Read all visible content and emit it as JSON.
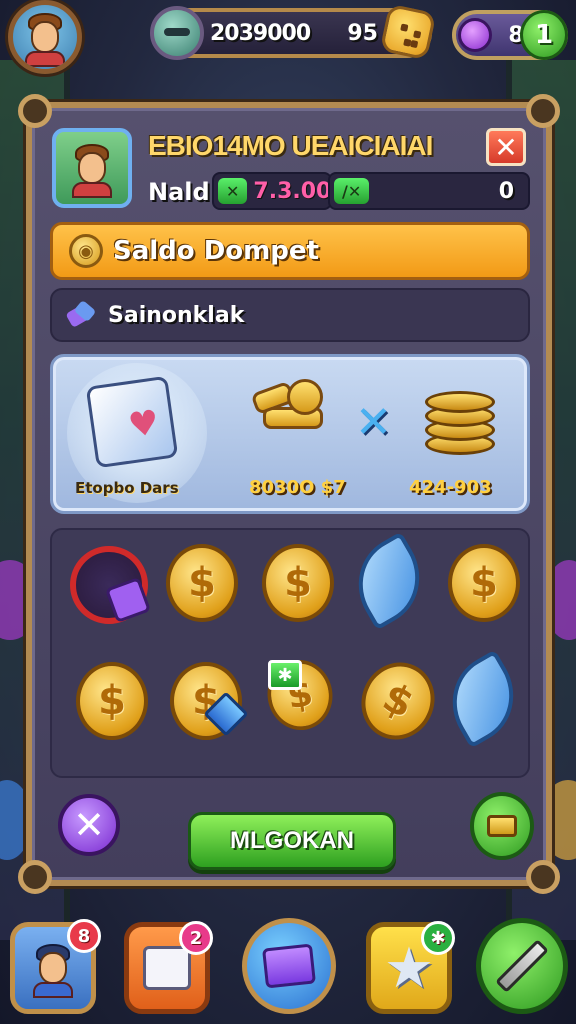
{
  "top_bar": {
    "currency_amount": "2039000",
    "currency_secondary": "95",
    "gem_count": "8",
    "gem_plus": "1"
  },
  "panel": {
    "title": "EBIO14MO UEAICIAIAI",
    "close_glyph": "✕",
    "player_name": "Nald",
    "stat_left_pill": "✕",
    "stat_left_value": "7.3.00",
    "stat_right_pill": "/✕",
    "stat_right_value": "0"
  },
  "saldo": {
    "label": "Saldo Dompet",
    "coin_glyph": "◉"
  },
  "section": {
    "label": "Sainonklak"
  },
  "featured": {
    "label_a": "Etopbo Dars",
    "label_b": "8030O $7",
    "label_c": "424-903",
    "x_glyph": "✕"
  },
  "rewards": {
    "coin_glyph": "$",
    "tag_glyph": "✱"
  },
  "actions": {
    "cancel_glyph": "✕",
    "main_button": "MLGOKAN"
  },
  "bottom_nav": {
    "profile_badge": "8",
    "inbox_badge": "2",
    "star_badge": "✱"
  },
  "colors": {
    "panel_border": "#b38b52",
    "accent_orange": "#f29a16",
    "accent_green": "#2ea020",
    "accent_purple": "#7a2ad0"
  },
  "icons": [
    "avatar-icon",
    "cookie-icon",
    "gem-icon",
    "plus-icon",
    "close-icon",
    "coin-icon",
    "puzzle-icon",
    "gift-box-icon",
    "gold-bars-icon",
    "coin-stack-icon",
    "blade-icon",
    "lock-icon"
  ]
}
